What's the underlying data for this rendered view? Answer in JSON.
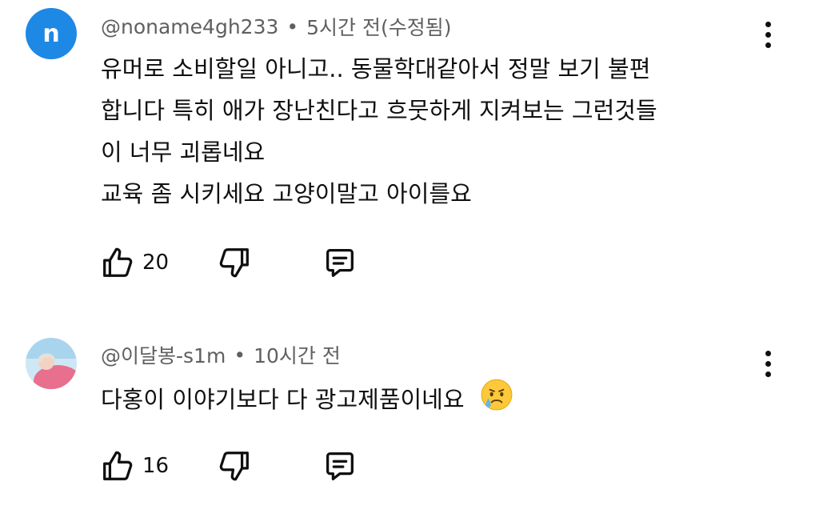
{
  "comments": [
    {
      "author": "@noname4gh233",
      "time": "5시간 전(수정됨)",
      "avatar_letter": "n",
      "avatar_color": "#1e88e5",
      "lines": [
        "유머로 소비할일 아니고.. 동물학대같아서 정말 보기 불편",
        "합니다 특히 애가 장난친다고 흐뭇하게 지켜보는 그런것들",
        "이 너무 괴롭네요",
        "교육 좀 시키세요 고양이말고 아이를요"
      ],
      "likes": "20"
    },
    {
      "author": "@이달봉-s1m",
      "time": "10시간 전",
      "text": "다홍이 이야기보다 다 광고제품이네요",
      "emoji": "crying-face",
      "likes": "16"
    }
  ],
  "separator": "•",
  "icons": {
    "like": "thumb-up-icon",
    "dislike": "thumb-down-icon",
    "reply": "reply-icon",
    "more": "more-vert-icon"
  }
}
